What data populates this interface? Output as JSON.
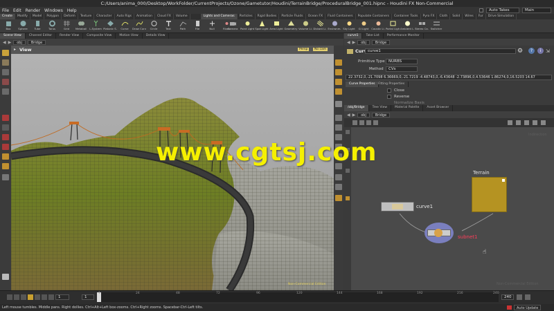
{
  "window": {
    "title": "C:/Users/anima_000/Desktop/WorkFolder/CurrentProjects/Ozone/Gametutor/Houdini/TerrainBridge/ProceduralBridge_001.hipnc - Houdini FX Non-Commercial"
  },
  "menu": [
    "File",
    "Edit",
    "Render",
    "Windows",
    "Help"
  ],
  "take": {
    "label": "Auto Takes",
    "desk": "Main"
  },
  "shelf_tabs_left": [
    "Create",
    "Modify",
    "Model",
    "Polygon",
    "Deform",
    "Texture",
    "Character",
    "Auto Rigs",
    "Animation",
    "Cloud FX",
    "Volume"
  ],
  "shelf_tabs_right": [
    "Lights and Cameras",
    "Particles",
    "Rigid Bodies",
    "Particle Fluids",
    "Ocean FX",
    "Fluid Containers",
    "Populate Containers",
    "Container Tools",
    "Pyro FX",
    "Cloth",
    "Solid",
    "Wires",
    "Fur",
    "Drive Simulation"
  ],
  "tools_left": [
    "Box",
    "Sphere",
    "Tube",
    "Torus",
    "Grid",
    "Metaball",
    "L-System",
    "Platonic S.",
    "Curve",
    "Draw Curve",
    "Circle",
    "Text",
    "Path",
    "File",
    "Null",
    "Rivet"
  ],
  "tools_right": [
    "Camera",
    "Point Light",
    "Spot Light",
    "Area Light",
    "Geometry",
    "Volume Li.",
    "Distant Li.",
    "Environm.",
    "Sky Light",
    "GI Light",
    "Caustic Li.",
    "Portal Light",
    "Ambient L.",
    "Stereo Ca.",
    "Switcher"
  ],
  "left_pane": {
    "tabs": [
      "Scene View",
      "Channel Editor",
      "Render View",
      "Composite View",
      "Motion View",
      "Details View"
    ],
    "path": [
      "obj",
      "Bridge"
    ],
    "view_label": "View",
    "persp": "Persp",
    "cam": "No cam",
    "watermark_nc": "Non-Commercial Edition"
  },
  "params_pane": {
    "tabs": [
      "curve1",
      "Take List",
      "Performance Monitor"
    ],
    "node_type": "Curve",
    "node_name": "curve1",
    "rows": [
      {
        "label": "Primitive Type",
        "value": "NURBS"
      },
      {
        "label": "Method",
        "value": "CVs"
      }
    ],
    "coords": "22.3732,0,-21.7098 6.36669,0,-21.7219 -4.48743,0,-6.43648 -2.73896,0,4.53646 1.86274,0,16.5203 14.67",
    "subtabs": [
      "Curve Properties",
      "Fitting Properties"
    ],
    "checks": [
      "Close",
      "Reverse",
      "Normalize Basis"
    ]
  },
  "network_pane": {
    "tabs": [
      "/obj/Bridge",
      "Tree View",
      "Material Palette",
      "Asset Browser"
    ],
    "path": [
      "obj",
      "Bridge"
    ],
    "nodes": {
      "curve": "curve1",
      "subnet": "subnet1",
      "terrain": "Terrain"
    },
    "corner_top": "Indirection",
    "corner_bottom": "Non-Commercial Edition"
  },
  "timeline": {
    "frame": "1",
    "start": "1",
    "end": "240",
    "ticks": [
      "1",
      "24",
      "48",
      "72",
      "96",
      "120",
      "144",
      "168",
      "192",
      "216",
      "240"
    ],
    "auto_update": "Auto Update"
  },
  "status": "Left mouse tumbles. Middle pans. Right dollies. Ctrl+Alt+Left box-zooms. Ctrl+Right zooms. Spacebar-Ctrl-Left tilts.",
  "overlay": "www.cgtsj.com"
}
